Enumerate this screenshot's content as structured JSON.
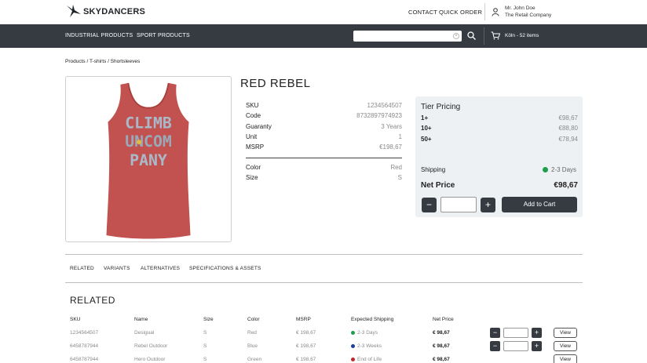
{
  "header": {
    "logo_text": "SKYDANCERS",
    "links": [
      "CONTACT",
      "QUICK ORDER"
    ],
    "user_name": "Mr. John Doe",
    "user_company": "The Retail Company"
  },
  "nav": {
    "items": [
      "INDUSTRIAL PRODUCTS",
      "SPORT PRODUCTS"
    ],
    "search_value": "",
    "cart_text": "Köln - 52 items"
  },
  "breadcrumb": "Products / T-shirts / Shortsleeves",
  "product": {
    "title": "RED REBEL",
    "image_text": [
      "CLIMB",
      "UNCOM",
      "PANY"
    ],
    "specs": [
      {
        "label": "SKU",
        "value": "1234564507"
      },
      {
        "label": "Code",
        "value": "8732897974923"
      },
      {
        "label": "Guaranty",
        "value": "3 Years"
      },
      {
        "label": "Unit",
        "value": "1"
      },
      {
        "label": "MSRP",
        "value": "€198,67"
      }
    ],
    "attributes": [
      {
        "label": "Color",
        "value": "Red"
      },
      {
        "label": "Size",
        "value": "S"
      }
    ]
  },
  "pricing": {
    "title": "Tier Pricing",
    "tiers": [
      {
        "qty": "1+",
        "price": "€98,67"
      },
      {
        "qty": "10+",
        "price": "€88,80"
      },
      {
        "qty": "50+",
        "price": "€78,94"
      }
    ],
    "shipping_label": "Shipping",
    "shipping_value": "2-3 Days",
    "shipping_color": "#1e9e4b",
    "net_price_label": "Net Price",
    "net_price_value": "€98,67",
    "minus": "−",
    "plus": "+",
    "qty_value": "",
    "add_to_cart": "Add to Cart"
  },
  "tabs": [
    "RELATED",
    "VARIANTS",
    "ALTERNATIVES",
    "SPECIFICATIONS & ASSETS"
  ],
  "related": {
    "title": "RELATED",
    "columns": [
      "SKU",
      "Name",
      "Size",
      "Color",
      "MSRP",
      "Expected Shipping",
      "Net Price"
    ],
    "rows": [
      {
        "sku": "1234564507",
        "name": "Desigual",
        "size": "S",
        "color": "Red",
        "msrp": "€ 198,67",
        "shipping": "2-3 Days",
        "shipping_color": "#1e9e4b",
        "net": "€ 98,67"
      },
      {
        "sku": "6458787944",
        "name": "Rebel Outdoor",
        "size": "S",
        "color": "Blue",
        "msrp": "€ 198,67",
        "shipping": "2-3 Weeks",
        "shipping_color": "#1f3f9e",
        "net": "€ 98,67"
      },
      {
        "sku": "6458787944",
        "name": "Hero Outdoor",
        "size": "S",
        "color": "Green",
        "msrp": "€ 198,67",
        "shipping": "End of Life",
        "shipping_color": "#c0282d",
        "net": "€ 98,67"
      }
    ],
    "view_label": "View",
    "minus": "−",
    "plus": "+"
  }
}
